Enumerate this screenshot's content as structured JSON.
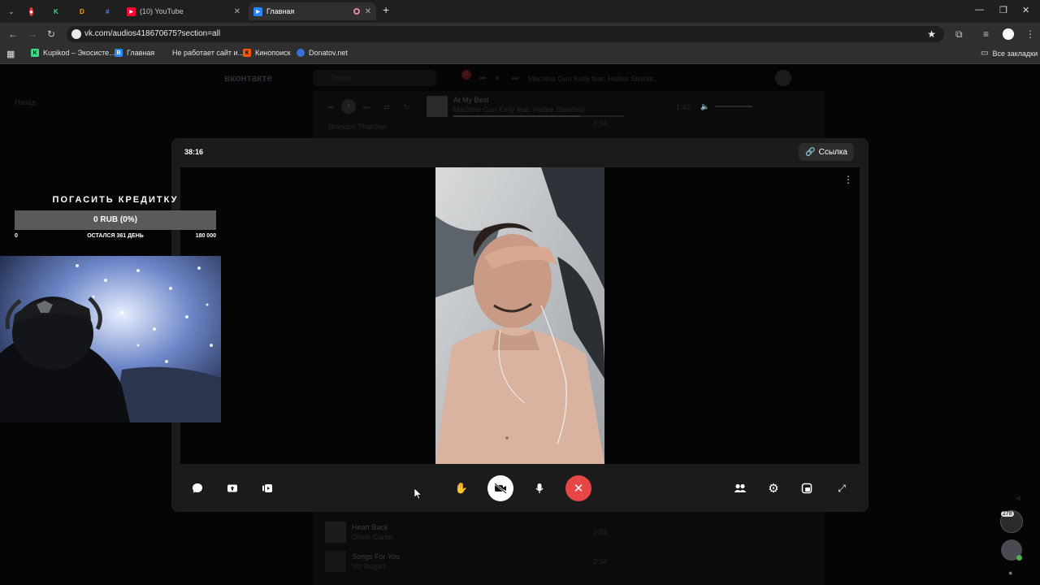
{
  "browser": {
    "tabs": [
      {
        "label": "(10) YouTube",
        "active": false
      },
      {
        "label": "Главная",
        "active": true
      }
    ],
    "url": "vk.com/audios418670675?section=all",
    "bookmarks": [
      "Kupikod – Экосисте...",
      "Главная",
      "Не работает сайт и...",
      "Кинопоиск",
      "Donatov.net"
    ],
    "all_bookmarks": "Все закладки"
  },
  "vk": {
    "logo": "вконтакте",
    "search_placeholder": "Поиск",
    "notif_count": "11",
    "header_track": "Machine Gun Kelly feat. Hailee Steinfe...",
    "back_label": "Назад",
    "now_playing": {
      "title": "At My Best",
      "artist": "Machine Gun Kelly feat. Hailee Steinfeld",
      "time": "1:42"
    },
    "tracks": [
      {
        "title": "Brandon Thatcher",
        "artist": "",
        "time": "3:34"
      },
      {
        "title": "Heart Back",
        "artist": "Oliver Carter",
        "time": "2:52"
      },
      {
        "title": "Songs For You",
        "artist": "Viz Bugart",
        "time": "2:34"
      }
    ],
    "chat_badge": "278"
  },
  "call": {
    "timer": "38:16",
    "link_label": "Ссылка"
  },
  "stream": {
    "goal_title": "ПОГАСИТЬ КРЕДИТКУ",
    "goal_progress": "0 RUB (0%)",
    "goal_min": "0",
    "goal_remaining": "ОСТАЛСЯ 361 ДЕНЬ",
    "goal_max": "180 000",
    "goal_fraction": 0
  }
}
